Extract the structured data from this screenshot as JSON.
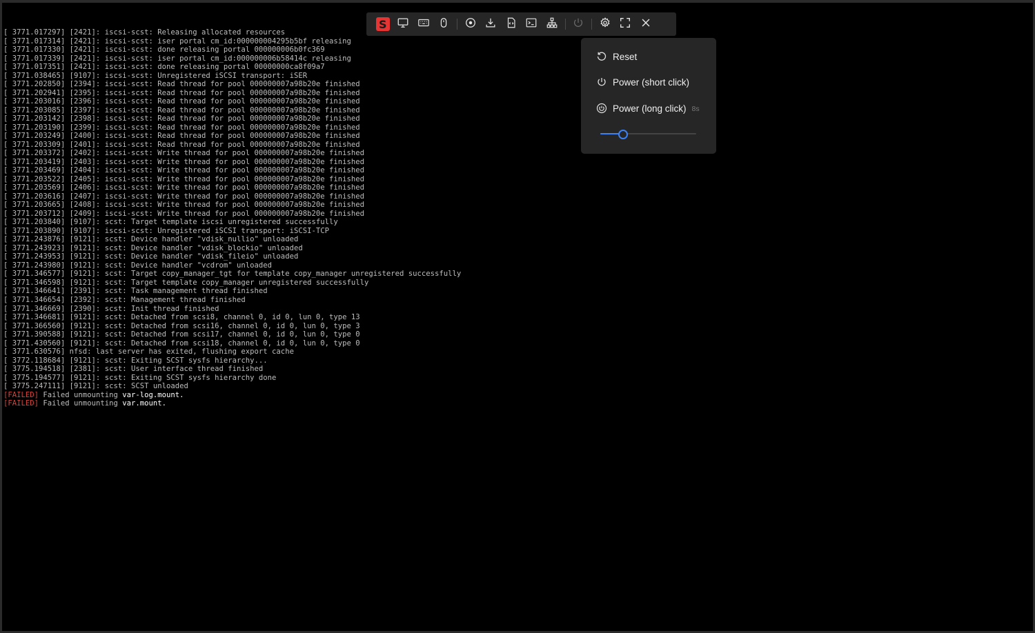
{
  "console": {
    "lines": [
      "[ 3771.017297] [2421]: iscsi-scst: Releasing allocated resources",
      "[ 3771.017314] [2421]: iscsi-scst: iser portal cm_id:000000004295b5bf releasing",
      "[ 3771.017330] [2421]: iscsi-scst: done releasing portal 000000006b0fc369",
      "[ 3771.017339] [2421]: iscsi-scst: iser portal cm_id:000000006b58414c releasing",
      "[ 3771.017351] [2421]: iscsi-scst: done releasing portal 00000000ca8f09a7",
      "[ 3771.038465] [9107]: iscsi-scst: Unregistered iSCSI transport: iSER",
      "[ 3771.202850] [2394]: iscsi-scst: Read thread for pool 000000007a98b20e finished",
      "[ 3771.202941] [2395]: iscsi-scst: Read thread for pool 000000007a98b20e finished",
      "[ 3771.203016] [2396]: iscsi-scst: Read thread for pool 000000007a98b20e finished",
      "[ 3771.203085] [2397]: iscsi-scst: Read thread for pool 000000007a98b20e finished",
      "[ 3771.203142] [2398]: iscsi-scst: Read thread for pool 000000007a98b20e finished",
      "[ 3771.203190] [2399]: iscsi-scst: Read thread for pool 000000007a98b20e finished",
      "[ 3771.203249] [2400]: iscsi-scst: Read thread for pool 000000007a98b20e finished",
      "[ 3771.203309] [2401]: iscsi-scst: Read thread for pool 000000007a98b20e finished",
      "[ 3771.203372] [2402]: iscsi-scst: Write thread for pool 000000007a98b20e finished",
      "[ 3771.203419] [2403]: iscsi-scst: Write thread for pool 000000007a98b20e finished",
      "[ 3771.203469] [2404]: iscsi-scst: Write thread for pool 000000007a98b20e finished",
      "[ 3771.203522] [2405]: iscsi-scst: Write thread for pool 000000007a98b20e finished",
      "[ 3771.203569] [2406]: iscsi-scst: Write thread for pool 000000007a98b20e finished",
      "[ 3771.203616] [2407]: iscsi-scst: Write thread for pool 000000007a98b20e finished",
      "[ 3771.203665] [2408]: iscsi-scst: Write thread for pool 000000007a98b20e finished",
      "[ 3771.203712] [2409]: iscsi-scst: Write thread for pool 000000007a98b20e finished",
      "[ 3771.203840] [9107]: scst: Target template iscsi unregistered successfully",
      "[ 3771.203890] [9107]: iscsi-scst: Unregistered iSCSI transport: iSCSI-TCP",
      "[ 3771.243876] [9121]: scst: Device handler \"vdisk_nullio\" unloaded",
      "[ 3771.243923] [9121]: scst: Device handler \"vdisk_blockio\" unloaded",
      "[ 3771.243953] [9121]: scst: Device handler \"vdisk_fileio\" unloaded",
      "[ 3771.243980] [9121]: scst: Device handler \"vcdrom\" unloaded",
      "[ 3771.346577] [9121]: scst: Target copy_manager_tgt for template copy_manager unregistered successfully",
      "[ 3771.346598] [9121]: scst: Target template copy_manager unregistered successfully",
      "[ 3771.346641] [2391]: scst: Task management thread finished",
      "[ 3771.346654] [2392]: scst: Management thread finished",
      "[ 3771.346669] [2390]: scst: Init thread finished",
      "[ 3771.346681] [9121]: scst: Detached from scsi8, channel 0, id 0, lun 0, type 13",
      "[ 3771.366560] [9121]: scst: Detached from scsi16, channel 0, id 0, lun 0, type 3",
      "[ 3771.390588] [9121]: scst: Detached from scsi17, channel 0, id 0, lun 0, type 0",
      "[ 3771.430560] [9121]: scst: Detached from scsi18, channel 0, id 0, lun 0, type 0",
      "[ 3771.630576] nfsd: last server has exited, flushing export cache",
      "[ 3772.118684] [9121]: scst: Exiting SCST sysfs hierarchy...",
      "[ 3775.194518] [2381]: scst: User interface thread finished",
      "[ 3775.194577] [9121]: scst: Exiting SCST sysfs hierarchy done",
      "[ 3775.247111] [9121]: scst: SCST unloaded"
    ],
    "failed": [
      {
        "tag": "[FAILED]",
        "text": " Failed unmounting ",
        "unit": "var-log.mount",
        "end": "."
      },
      {
        "tag": "[FAILED]",
        "text": " Failed unmounting ",
        "unit": "var.mount",
        "end": "."
      }
    ]
  },
  "toolbar": {
    "logo_letter": "S",
    "logo_color": "#e53431",
    "buttons": [
      "monitor-icon",
      "keyboard-icon",
      "mouse-icon",
      "disc-icon",
      "download-icon",
      "file-code-icon",
      "terminal-icon",
      "network-icon",
      "power-icon",
      "gear-icon",
      "fullscreen-icon",
      "close-icon"
    ]
  },
  "power_menu": {
    "reset_label": "Reset",
    "short_click_label": "Power (short click)",
    "long_click_label": "Power (long click)",
    "long_click_hint": "8s",
    "duration_fraction": 0.24,
    "accent_color": "#3b82f6"
  }
}
